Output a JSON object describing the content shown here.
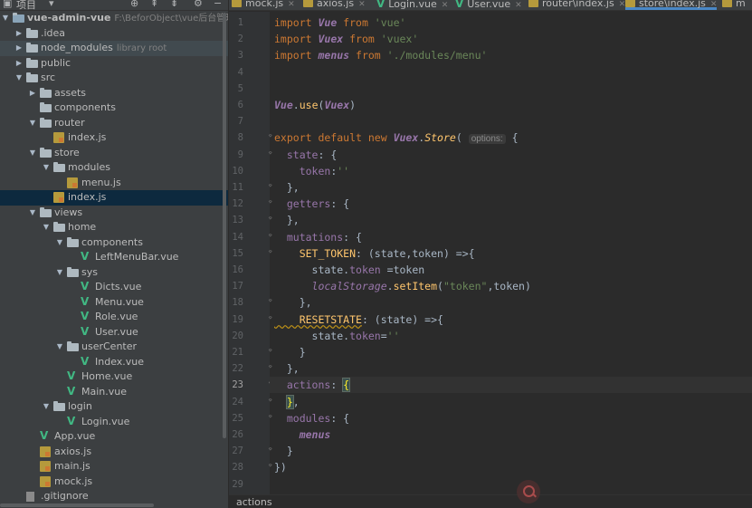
{
  "project_panel": {
    "title": "项目",
    "tree": [
      {
        "label": "vue-admin-vue",
        "extra": "F:\\BeforObject\\vue后台管理\\",
        "kind": "root",
        "depth": 0,
        "arrow": "down"
      },
      {
        "label": ".idea",
        "kind": "folder",
        "depth": 1,
        "arrow": "right"
      },
      {
        "label": "node_modules",
        "extra": "library root",
        "kind": "folder",
        "depth": 1,
        "arrow": "right",
        "hover": true
      },
      {
        "label": "public",
        "kind": "folder",
        "depth": 1,
        "arrow": "right"
      },
      {
        "label": "src",
        "kind": "folder",
        "depth": 1,
        "arrow": "down"
      },
      {
        "label": "assets",
        "kind": "folder",
        "depth": 2,
        "arrow": "right"
      },
      {
        "label": "components",
        "kind": "folder",
        "depth": 2,
        "arrow": ""
      },
      {
        "label": "router",
        "kind": "folder",
        "depth": 2,
        "arrow": "down"
      },
      {
        "label": "index.js",
        "kind": "js",
        "depth": 3,
        "arrow": ""
      },
      {
        "label": "store",
        "kind": "folder",
        "depth": 2,
        "arrow": "down"
      },
      {
        "label": "modules",
        "kind": "folder",
        "depth": 3,
        "arrow": "down"
      },
      {
        "label": "menu.js",
        "kind": "js",
        "depth": 4,
        "arrow": ""
      },
      {
        "label": "index.js",
        "kind": "js",
        "depth": 3,
        "arrow": "",
        "selected": true
      },
      {
        "label": "views",
        "kind": "folder",
        "depth": 2,
        "arrow": "down"
      },
      {
        "label": "home",
        "kind": "folder",
        "depth": 3,
        "arrow": "down"
      },
      {
        "label": "components",
        "kind": "folder",
        "depth": 4,
        "arrow": "down"
      },
      {
        "label": "LeftMenuBar.vue",
        "kind": "vue",
        "depth": 5,
        "arrow": ""
      },
      {
        "label": "sys",
        "kind": "folder",
        "depth": 4,
        "arrow": "down"
      },
      {
        "label": "Dicts.vue",
        "kind": "vue",
        "depth": 5,
        "arrow": ""
      },
      {
        "label": "Menu.vue",
        "kind": "vue",
        "depth": 5,
        "arrow": ""
      },
      {
        "label": "Role.vue",
        "kind": "vue",
        "depth": 5,
        "arrow": ""
      },
      {
        "label": "User.vue",
        "kind": "vue",
        "depth": 5,
        "arrow": ""
      },
      {
        "label": "userCenter",
        "kind": "folder",
        "depth": 4,
        "arrow": "down"
      },
      {
        "label": "Index.vue",
        "kind": "vue",
        "depth": 5,
        "arrow": ""
      },
      {
        "label": "Home.vue",
        "kind": "vue",
        "depth": 4,
        "arrow": ""
      },
      {
        "label": "Main.vue",
        "kind": "vue",
        "depth": 4,
        "arrow": ""
      },
      {
        "label": "login",
        "kind": "folder",
        "depth": 3,
        "arrow": "down"
      },
      {
        "label": "Login.vue",
        "kind": "vue",
        "depth": 4,
        "arrow": ""
      },
      {
        "label": "App.vue",
        "kind": "vue",
        "depth": 2,
        "arrow": ""
      },
      {
        "label": "axios.js",
        "kind": "js",
        "depth": 2,
        "arrow": ""
      },
      {
        "label": "main.js",
        "kind": "js",
        "depth": 2,
        "arrow": ""
      },
      {
        "label": "mock.js",
        "kind": "js",
        "depth": 2,
        "arrow": ""
      },
      {
        "label": ".gitignore",
        "kind": "file",
        "depth": 1,
        "arrow": ""
      }
    ]
  },
  "tabs": [
    {
      "label": "mock.js",
      "kind": "js",
      "active": false
    },
    {
      "label": "axios.js",
      "kind": "js",
      "active": false
    },
    {
      "label": "Login.vue",
      "kind": "vue",
      "active": false
    },
    {
      "label": "User.vue",
      "kind": "vue",
      "active": false
    },
    {
      "label": "router\\index.js",
      "kind": "js",
      "active": false
    },
    {
      "label": "store\\index.js",
      "kind": "js",
      "active": true
    },
    {
      "label": "m",
      "kind": "js",
      "active": false
    }
  ],
  "editor": {
    "current_line": 23,
    "line_count": 29,
    "breadcrumb": "actions",
    "param_hint": "options:"
  },
  "code": [
    [
      [
        "kw",
        "import "
      ],
      [
        "it2",
        "Vue"
      ],
      [
        "kw",
        " from "
      ],
      [
        "str",
        "'vue'"
      ]
    ],
    [
      [
        "kw",
        "import "
      ],
      [
        "it2",
        "Vuex"
      ],
      [
        "kw",
        " from "
      ],
      [
        "str",
        "'vuex'"
      ]
    ],
    [
      [
        "kw",
        "import "
      ],
      [
        "it2",
        "menus"
      ],
      [
        "kw",
        " from "
      ],
      [
        "str",
        "'./modules/menu'"
      ]
    ],
    [],
    [],
    [
      [
        "it2",
        "Vue"
      ],
      [
        "",
        "."
      ],
      [
        "fn",
        "use"
      ],
      [
        "",
        "("
      ],
      [
        "it2",
        "Vuex"
      ],
      [
        "",
        ")"
      ]
    ],
    [],
    [
      [
        "kw",
        "export default new "
      ],
      [
        "it2",
        "Vuex"
      ],
      [
        "",
        "."
      ],
      [
        "fni",
        "Store"
      ],
      [
        "",
        "( "
      ],
      [
        "hint",
        "options:"
      ],
      [
        "",
        " {"
      ]
    ],
    [
      [
        "",
        ""
      ],
      [
        "prop",
        "  state"
      ],
      [
        "",
        ": {"
      ]
    ],
    [
      [
        "prop",
        "    token"
      ],
      [
        "",
        ":"
      ],
      [
        "str",
        "''"
      ]
    ],
    [
      [
        "",
        "  },"
      ]
    ],
    [
      [
        "prop",
        "  getters"
      ],
      [
        "",
        ": {"
      ]
    ],
    [
      [
        "",
        "  },"
      ]
    ],
    [
      [
        "prop",
        "  mutations"
      ],
      [
        "",
        ": {"
      ]
    ],
    [
      [
        "fn",
        "    SET_TOKEN"
      ],
      [
        "",
        ": (state,token) =>{"
      ]
    ],
    [
      [
        "",
        "      state."
      ],
      [
        "prop",
        "token"
      ],
      [
        "",
        " =token"
      ]
    ],
    [
      [
        "it",
        "      localStorage"
      ],
      [
        "",
        "."
      ],
      [
        "fn",
        "setItem"
      ],
      [
        "",
        "("
      ],
      [
        "str",
        "\"token\""
      ],
      [
        "",
        ",token)"
      ]
    ],
    [
      [
        "",
        "    },"
      ]
    ],
    [
      [
        "fnu",
        "    RESETSTATE"
      ],
      [
        "",
        ": (state) =>{"
      ]
    ],
    [
      [
        "",
        "      state."
      ],
      [
        "prop",
        "token"
      ],
      [
        "",
        "="
      ],
      [
        "str",
        "''"
      ]
    ],
    [
      [
        "",
        "    }"
      ]
    ],
    [
      [
        "",
        "  },"
      ]
    ],
    [
      [
        "prop",
        "  actions"
      ],
      [
        "",
        ": "
      ],
      [
        "bm",
        "{"
      ]
    ],
    [
      [
        "",
        "  "
      ],
      [
        "bm",
        "}"
      ],
      [
        "",
        ","
      ]
    ],
    [
      [
        "prop",
        "  modules"
      ],
      [
        "",
        ": {"
      ]
    ],
    [
      [
        "it2",
        "    menus"
      ]
    ],
    [
      [
        "",
        "  }"
      ]
    ],
    [
      [
        "",
        "})"
      ]
    ],
    []
  ]
}
